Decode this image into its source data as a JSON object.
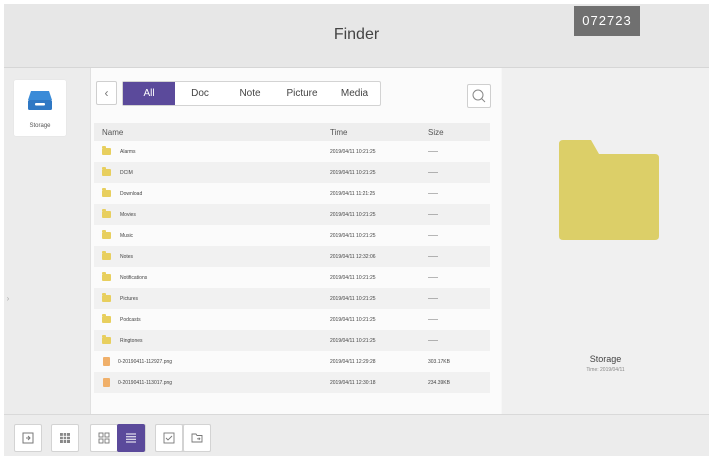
{
  "window": {
    "title": "Finder",
    "code_badge": "072723"
  },
  "sidebar": {
    "items": [
      {
        "label": "Storage",
        "icon": "storage-icon"
      }
    ]
  },
  "toolbar": {
    "back_icon": "chevron-left-icon",
    "tabs": [
      {
        "label": "All",
        "active": true
      },
      {
        "label": "Doc",
        "active": false
      },
      {
        "label": "Note",
        "active": false
      },
      {
        "label": "Picture",
        "active": false
      },
      {
        "label": "Media",
        "active": false
      }
    ],
    "search_icon": "search-icon"
  },
  "file_list": {
    "columns": {
      "name": "Name",
      "time": "Time",
      "size": "Size"
    },
    "rows": [
      {
        "name": "Alarms",
        "time": "2019/04/11 10:21:25",
        "size": "——",
        "type": "folder"
      },
      {
        "name": "DCIM",
        "time": "2019/04/11 10:21:25",
        "size": "——",
        "type": "folder"
      },
      {
        "name": "Download",
        "time": "2019/04/11 11:21:25",
        "size": "——",
        "type": "folder"
      },
      {
        "name": "Movies",
        "time": "2019/04/11 10:21:25",
        "size": "——",
        "type": "folder"
      },
      {
        "name": "Music",
        "time": "2019/04/11 10:21:25",
        "size": "——",
        "type": "folder"
      },
      {
        "name": "Notes",
        "time": "2019/04/11 12:32:06",
        "size": "——",
        "type": "folder"
      },
      {
        "name": "Notifications",
        "time": "2019/04/11 10:21:25",
        "size": "——",
        "type": "folder"
      },
      {
        "name": "Pictures",
        "time": "2019/04/11 10:21:25",
        "size": "——",
        "type": "folder"
      },
      {
        "name": "Podcasts",
        "time": "2019/04/11 10:21:25",
        "size": "——",
        "type": "folder"
      },
      {
        "name": "Ringtones",
        "time": "2019/04/11 10:21:25",
        "size": "——",
        "type": "folder"
      },
      {
        "name": "0-20190411-112927.png",
        "time": "2019/04/11 12:29:28",
        "size": "303.17KB",
        "type": "image"
      },
      {
        "name": "0-20190411-113017.png",
        "time": "2019/04/11 12:30:18",
        "size": "234.39KB",
        "type": "image"
      }
    ]
  },
  "preview": {
    "name": "Storage",
    "time": "Time: 2019/04/11"
  },
  "bottom_bar": {
    "buttons": [
      {
        "icon": "exit-icon",
        "active": false
      },
      {
        "icon": "grid-small-icon",
        "active": false
      },
      {
        "icon": "grid-view-icon",
        "active": false
      },
      {
        "icon": "list-view-icon",
        "active": true
      },
      {
        "icon": "select-check-icon",
        "active": false
      },
      {
        "icon": "move-to-icon",
        "active": false
      }
    ]
  },
  "colors": {
    "accent": "#5b4a9b",
    "folder": "#e8cf5e",
    "image_file": "#f0b06a",
    "title_bar": "#e7e7e7"
  }
}
